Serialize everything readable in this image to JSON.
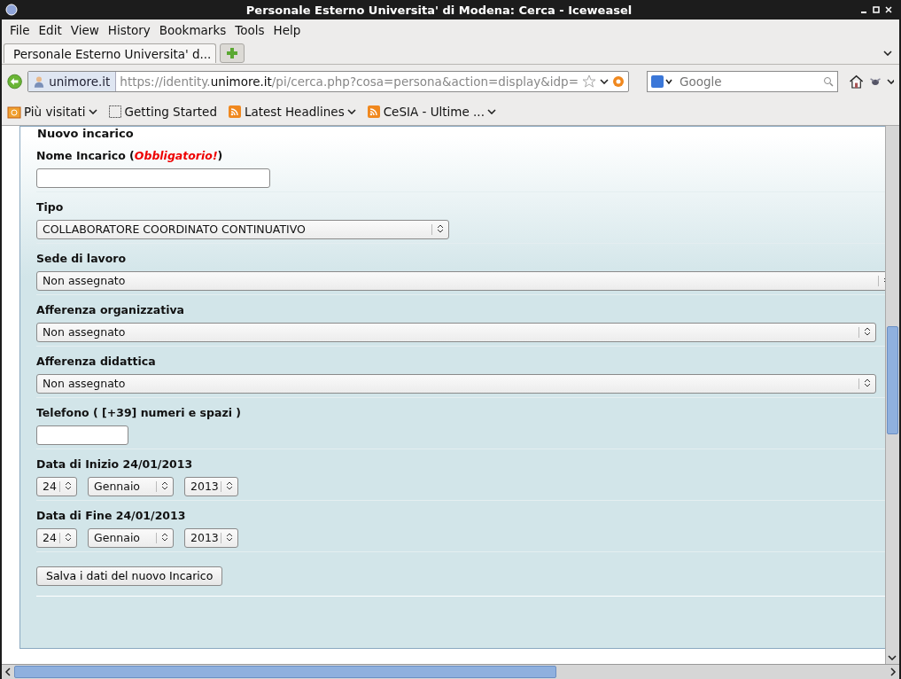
{
  "window": {
    "title": "Personale Esterno Universita' di Modena: Cerca - Iceweasel"
  },
  "menu": [
    "File",
    "Edit",
    "View",
    "History",
    "Bookmarks",
    "Tools",
    "Help"
  ],
  "tabs": [
    {
      "label": "Personale Esterno Universita' d...",
      "selected": true
    }
  ],
  "navbar": {
    "identity": "unimore.it",
    "url_prefix": "https://identity.",
    "url_host": "unimore.it",
    "url_path": "/pi/cerca.php?cosa=persona&action=display&idp=",
    "search_placeholder": "Google"
  },
  "bookmarks": [
    {
      "kind": "folder",
      "label": "Più visitati",
      "dropdown": true
    },
    {
      "kind": "page",
      "label": "Getting Started",
      "dropdown": false
    },
    {
      "kind": "feed",
      "label": "Latest Headlines",
      "dropdown": true
    },
    {
      "kind": "feed",
      "label": "CeSIA  - Ultime ...",
      "dropdown": true
    }
  ],
  "form": {
    "legend": "Nuovo incarico",
    "fields": [
      {
        "kind": "text",
        "label": "Nome Incarico (*Obbligatorio!*)"
      },
      {
        "kind": "select",
        "label": "Tipo",
        "value": "COLLABORATORE COORDINATO CONTINUATIVO"
      },
      {
        "kind": "select",
        "label": "Sede di lavoro",
        "value": "Non assegnato"
      },
      {
        "kind": "select",
        "label": "Afferenza organizzativa",
        "value": "Non assegnato"
      },
      {
        "kind": "select",
        "label": "Afferenza didattica",
        "value": "Non assegnato"
      },
      {
        "kind": "text",
        "label": "Telefono ( [+39] numeri e spazi )"
      },
      {
        "kind": "date",
        "label": "Data di Inizio 24/01/2013",
        "day": "24",
        "month": "Gennaio",
        "year": "2013"
      },
      {
        "kind": "date",
        "label": "Data di Fine 24/01/2013",
        "day": "24",
        "month": "Gennaio",
        "year": "2013"
      },
      {
        "kind": "button",
        "label": "Salva i dati del nuovo Incarico"
      }
    ]
  }
}
